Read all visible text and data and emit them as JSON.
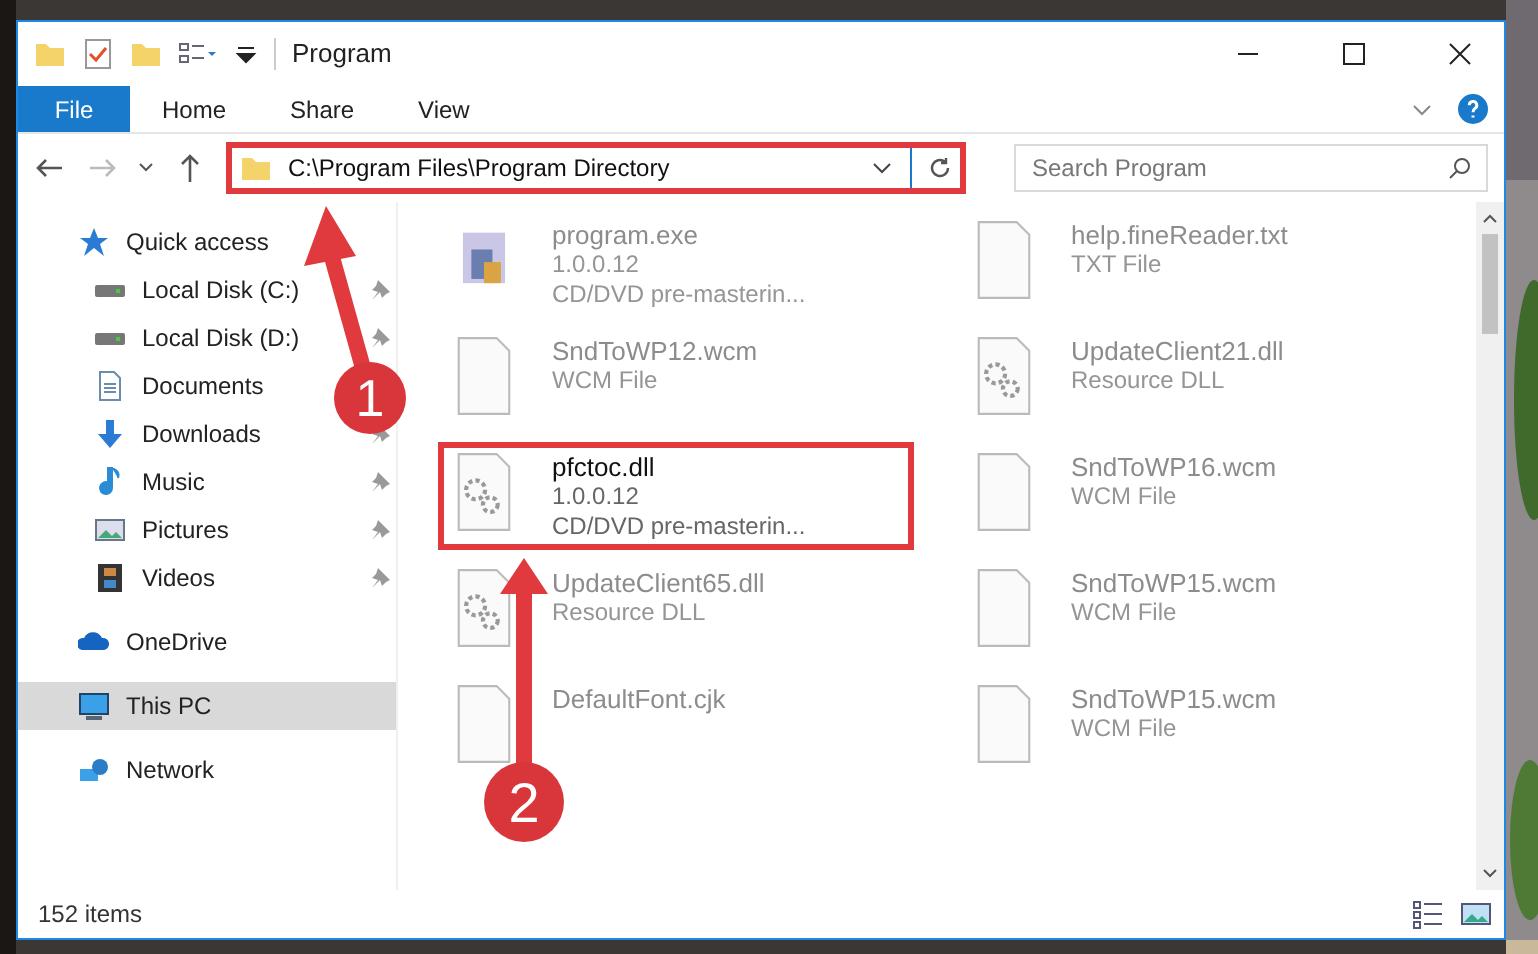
{
  "window": {
    "title": "Program"
  },
  "ribbon_tabs": [
    {
      "label": "File",
      "kind": "file"
    },
    {
      "label": "Home",
      "kind": "tab"
    },
    {
      "label": "Share",
      "kind": "tab"
    },
    {
      "label": "View",
      "kind": "tab"
    }
  ],
  "address_bar": {
    "path": "C:\\Program Files\\Program Directory",
    "highlighted": true
  },
  "search": {
    "placeholder": "Search Program"
  },
  "sidebar": {
    "items": [
      {
        "label": "Quick access",
        "selected": false,
        "children": [
          {
            "label": "Local Disk (C:)",
            "pinned": true,
            "selected": false
          },
          {
            "label": "Local Disk (D:)",
            "pinned": true,
            "selected": false
          },
          {
            "label": "Documents",
            "selected": false
          },
          {
            "label": "Downloads",
            "pinned": true,
            "selected": false
          },
          {
            "label": "Music",
            "pinned": true,
            "selected": false
          },
          {
            "label": "Pictures",
            "pinned": true,
            "selected": false
          },
          {
            "label": "Videos",
            "pinned": true,
            "selected": false
          }
        ]
      },
      {
        "label": "OneDrive",
        "selected": false
      },
      {
        "label": "This PC",
        "selected": true
      },
      {
        "label": "Network",
        "selected": false
      }
    ]
  },
  "files": [
    {
      "name": "program.exe",
      "details": [
        "1.0.0.12",
        "CD/DVD pre-masterin..."
      ],
      "kind": "exe",
      "highlighted": false
    },
    {
      "name": "help.fineReader.txt",
      "details": [
        "TXT File"
      ],
      "kind": "blank",
      "highlighted": false
    },
    {
      "name": "SndToWP12.wcm",
      "details": [
        "WCM File"
      ],
      "kind": "blank",
      "highlighted": false
    },
    {
      "name": "UpdateClient21.dll",
      "details": [
        "Resource DLL"
      ],
      "kind": "gear",
      "highlighted": false
    },
    {
      "name": "pfctoc.dll",
      "details": [
        "1.0.0.12",
        "CD/DVD pre-masterin..."
      ],
      "kind": "gear",
      "highlighted": true
    },
    {
      "name": "SndToWP16.wcm",
      "details": [
        "WCM File"
      ],
      "kind": "blank",
      "highlighted": false
    },
    {
      "name": "UpdateClient65.dll",
      "details": [
        "Resource DLL"
      ],
      "kind": "gear",
      "highlighted": false
    },
    {
      "name": "SndToWP15.wcm",
      "details": [
        "WCM File"
      ],
      "kind": "blank",
      "highlighted": false
    },
    {
      "name": "DefaultFont.cjk",
      "kind": "blank",
      "highlighted": false
    },
    {
      "name": "SndToWP15.wcm",
      "details": [
        "WCM File"
      ],
      "kind": "blank",
      "highlighted": false
    }
  ],
  "status_bar": {
    "count": "152 items"
  },
  "callouts": [
    {
      "number": "1"
    },
    {
      "number": "2"
    }
  ]
}
